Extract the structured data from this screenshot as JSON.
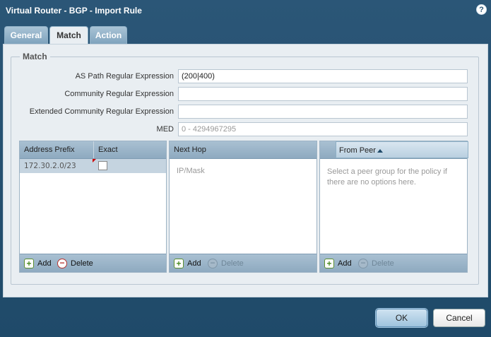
{
  "dialog": {
    "title": "Virtual Router - BGP - Import Rule",
    "help_icon": "help-icon"
  },
  "tabs": [
    {
      "label": "General",
      "active": false
    },
    {
      "label": "Match",
      "active": true
    },
    {
      "label": "Action",
      "active": false
    }
  ],
  "match": {
    "legend": "Match",
    "as_path": {
      "label": "AS Path Regular Expression",
      "value": "(200|400)"
    },
    "community": {
      "label": "Community Regular Expression",
      "value": ""
    },
    "ext_community": {
      "label": "Extended Community Regular Expression",
      "value": ""
    },
    "med": {
      "label": "MED",
      "placeholder": "0 - 4294967295"
    }
  },
  "address_prefix_grid": {
    "columns": [
      "Address Prefix",
      "Exact"
    ],
    "rows": [
      {
        "prefix": "172.30.2.0/23",
        "exact": false
      }
    ],
    "add_label": "Add",
    "delete_label": "Delete"
  },
  "next_hop_grid": {
    "column": "Next Hop",
    "placeholder": "IP/Mask",
    "add_label": "Add",
    "delete_label": "Delete"
  },
  "from_peer_grid": {
    "column": "From Peer",
    "empty_text_line1": "Select a peer group for the policy if",
    "empty_text_line2": "there are no options here.",
    "add_label": "Add",
    "delete_label": "Delete"
  },
  "buttons": {
    "ok": "OK",
    "cancel": "Cancel"
  },
  "colors": {
    "chrome": "#2b5677",
    "panel": "#e9eef2",
    "grid_header": "#a9c0d2"
  }
}
